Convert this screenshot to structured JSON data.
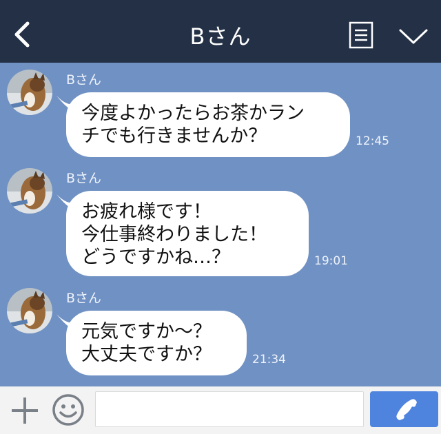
{
  "header": {
    "title": "Bさん",
    "back_icon": "chevron-left-icon",
    "notes_icon": "notes-icon",
    "menu_icon": "chevron-down-icon",
    "background": "#233046"
  },
  "chat": {
    "background": "#7091c3",
    "messages": [
      {
        "sender": "Bさん",
        "text": "今度よかったらお茶かラン\nチでも行きませんか？",
        "time": "12:45"
      },
      {
        "sender": "Bさん",
        "text": "お疲れ様です！\n今仕事終わりました！\nどうですかね…？",
        "time": "19:01"
      },
      {
        "sender": "Bさん",
        "text": "元気ですか〜？\n大丈夫ですか？",
        "time": "21:34"
      }
    ]
  },
  "input_bar": {
    "plus_icon": "plus-icon",
    "emoji_icon": "smiley-icon",
    "message_value": "",
    "call_icon": "phone-icon",
    "call_color": "#4f84de"
  }
}
